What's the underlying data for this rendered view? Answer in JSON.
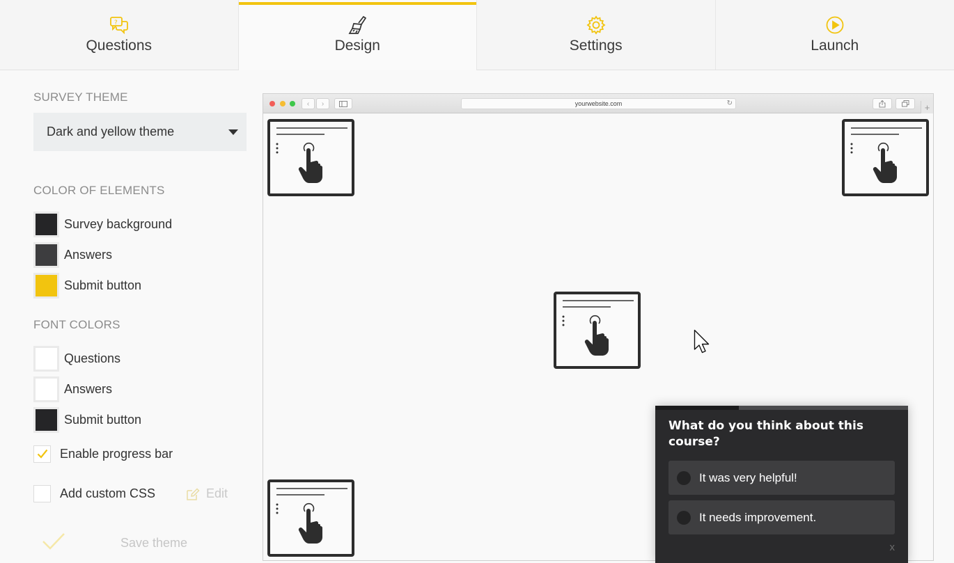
{
  "tabs": [
    {
      "label": "Questions",
      "icon": "chat-questions-icon",
      "active": false
    },
    {
      "label": "Design",
      "icon": "paintbrush-icon",
      "active": true
    },
    {
      "label": "Settings",
      "icon": "gear-icon",
      "active": false
    },
    {
      "label": "Launch",
      "icon": "play-circle-icon",
      "active": false
    }
  ],
  "panel": {
    "survey_theme_title": "SURVEY THEME",
    "theme_select_value": "Dark and yellow theme",
    "color_elements_title": "COLOR OF ELEMENTS",
    "color_elements": [
      {
        "label": "Survey background",
        "color": "#252527"
      },
      {
        "label": "Answers",
        "color": "#3d3d3f"
      },
      {
        "label": "Submit button",
        "color": "#f2c40f"
      }
    ],
    "font_colors_title": "FONT COLORS",
    "font_colors": [
      {
        "label": "Questions",
        "color": "#ffffff"
      },
      {
        "label": "Answers",
        "color": "#ffffff"
      },
      {
        "label": "Submit button",
        "color": "#252527"
      }
    ],
    "enable_progress_bar_label": "Enable progress bar",
    "enable_progress_bar_checked": true,
    "custom_css_label": "Add custom CSS",
    "custom_css_checked": false,
    "edit_label": "Edit",
    "save_label": "Save theme"
  },
  "browser": {
    "url": "yourwebsite.com"
  },
  "survey": {
    "progress": 0.33,
    "question": "What do you think about this course?",
    "answers": [
      "It was very helpful!",
      "It needs improvement."
    ],
    "close_label": "x"
  },
  "colors": {
    "accent": "#f2c40f",
    "dark": "#2a2a2c"
  }
}
